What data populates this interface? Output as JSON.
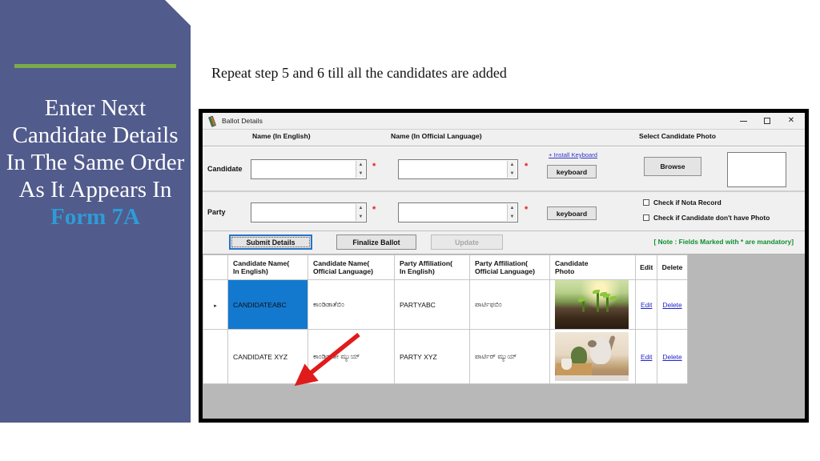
{
  "sidebar": {
    "title_lines": [
      "Enter Next",
      "Candidate Details",
      "In The Same",
      "Order As It",
      "Appears In "
    ],
    "title_plain": "Enter Next Candidate Details In The Same Order As It Appears In ",
    "title_highlight": "Form 7A",
    "accent_color": "#7aab4c",
    "background_color": "#515b8c",
    "highlight_color": "#2e9bd6"
  },
  "caption": "Repeat step 5 and 6 till all the candidates are added",
  "window": {
    "title": "Ballot Details",
    "icon": "ballot-app-icon",
    "minimize": "–",
    "maximize": "□",
    "close": "✕"
  },
  "column_captions": {
    "name_english": "Name (In English)",
    "name_official": "Name (In Official Language)",
    "select_photo": "Select Candidate Photo"
  },
  "form": {
    "candidate_label": "Candidate",
    "party_label": "Party",
    "required_marker": "*",
    "install_keyboard_link": "+ Install Keyboard",
    "keyboard_button": "keyboard",
    "browse_button": "Browse",
    "candidate_name_english": "",
    "candidate_name_official": "",
    "party_name_english": "",
    "party_name_official": "",
    "checkbox_nota": "Check if Nota Record",
    "checkbox_no_photo": "Check if Candidate don't have Photo"
  },
  "actions": {
    "submit": "Submit Details",
    "finalize": "Finalize Ballot",
    "update": "Update",
    "note": "[ Note : Fields Marked with * are mandatory]",
    "note_color": "#0e8f2e"
  },
  "grid": {
    "headers": [
      "Candidate Name(\nIn English)",
      "Candidate Name(\nOfficial Language)",
      "Party Affiliation(\nIn English)",
      "Party Affiliation(\nOfficial Language)",
      "Candidate\nPhoto",
      "Edit",
      "Delete"
    ],
    "header_lines": [
      [
        "Candidate Name(",
        "In English)"
      ],
      [
        "Candidate Name(",
        "Official Language)"
      ],
      [
        "Party Affiliation(",
        "In English)"
      ],
      [
        "Party Affiliation(",
        "Official Language)"
      ],
      [
        "Candidate",
        "Photo"
      ],
      [
        "Edit"
      ],
      [
        "Delete"
      ]
    ],
    "rows": [
      {
        "selector": "▸",
        "name_en": "CANDIDATEABC",
        "name_official": "ಕಾಂಡಿಡಾತೆಬಿಂ",
        "party_en": "PARTYABC",
        "party_official": "ಪಾರ್ಟಿಫಬಿಂ",
        "photo": "plant-seedlings-photo",
        "edit": "Edit",
        "delete": "Delete",
        "selected": true
      },
      {
        "selector": "",
        "name_en": "CANDIDATE XYZ",
        "name_official": "ಕಾಂಡಿಡಾತೇ ಮ್ಯುಯ್",
        "party_en": "PARTY XYZ",
        "party_official": "ಪಾರ್ಟಿರ್ ಮ್ಯುಯ್",
        "photo": "cat-on-shelf-photo",
        "edit": "Edit",
        "delete": "Delete",
        "selected": false
      }
    ],
    "selection_color": "#1379cf"
  },
  "annotation": {
    "arrow_color": "#e01b1b",
    "arrow_target": "candidate-name-english-cell-row2"
  }
}
